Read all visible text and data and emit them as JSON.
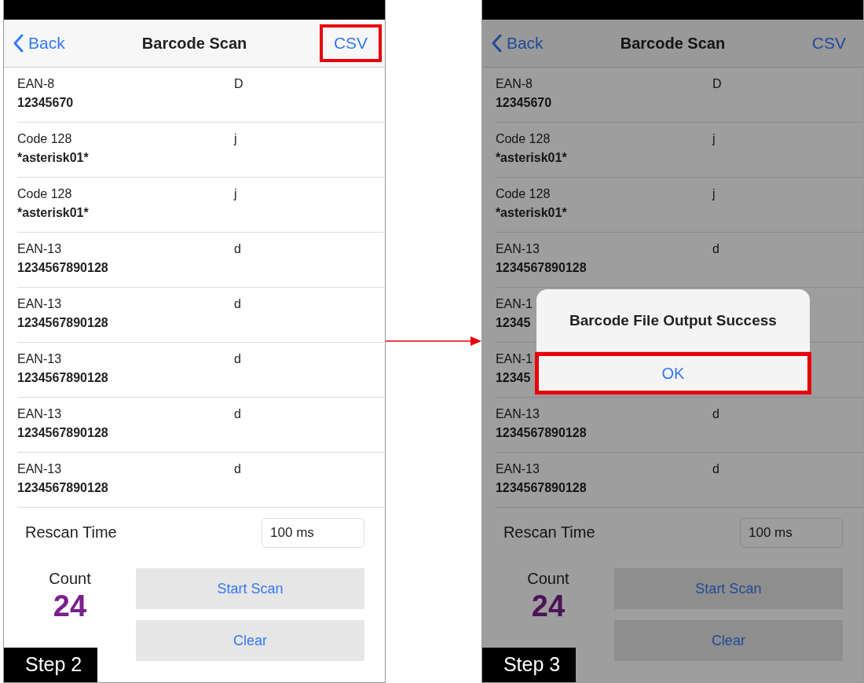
{
  "panels": [
    {
      "step_label": "Step 2",
      "dimmed": false,
      "nav": {
        "back": "Back",
        "title": "Barcode Scan",
        "action": "CSV",
        "action_highlighted": true
      },
      "rows": [
        {
          "type": "EAN-8",
          "data": "12345670",
          "code": "D"
        },
        {
          "type": "Code 128",
          "data": "*asterisk01*",
          "code": "j"
        },
        {
          "type": "Code 128",
          "data": "*asterisk01*",
          "code": "j"
        },
        {
          "type": "EAN-13",
          "data": "1234567890128",
          "code": "d"
        },
        {
          "type": "EAN-13",
          "data": "1234567890128",
          "code": "d"
        },
        {
          "type": "EAN-13",
          "data": "1234567890128",
          "code": "d"
        },
        {
          "type": "EAN-13",
          "data": "1234567890128",
          "code": "d"
        },
        {
          "type": "EAN-13",
          "data": "1234567890128",
          "code": "d"
        }
      ],
      "rescan": {
        "label": "Rescan Time",
        "value": "100 ms"
      },
      "count": {
        "label": "Count",
        "value": "24"
      },
      "buttons": [
        "Start Scan",
        "Clear"
      ]
    },
    {
      "step_label": "Step 3",
      "dimmed": true,
      "nav": {
        "back": "Back",
        "title": "Barcode Scan",
        "action": "CSV",
        "action_highlighted": false
      },
      "rows": [
        {
          "type": "EAN-8",
          "data": "12345670",
          "code": "D"
        },
        {
          "type": "Code 128",
          "data": "*asterisk01*",
          "code": "j"
        },
        {
          "type": "Code 128",
          "data": "*asterisk01*",
          "code": "j"
        },
        {
          "type": "EAN-13",
          "data": "1234567890128",
          "code": "d"
        },
        {
          "type": "EAN-1",
          "data": "12345"
        },
        {
          "type": "EAN-1",
          "data": "12345"
        },
        {
          "type": "EAN-13",
          "data": "1234567890128",
          "code": "d"
        },
        {
          "type": "EAN-13",
          "data": "1234567890128",
          "code": "d"
        }
      ],
      "rescan": {
        "label": "Rescan Time",
        "value": "100 ms"
      },
      "count": {
        "label": "Count",
        "value": "24"
      },
      "buttons": [
        "Start Scan",
        "Clear"
      ],
      "dialog": {
        "message": "Barcode File Output Success",
        "button": "OK",
        "button_highlighted": true
      }
    }
  ]
}
